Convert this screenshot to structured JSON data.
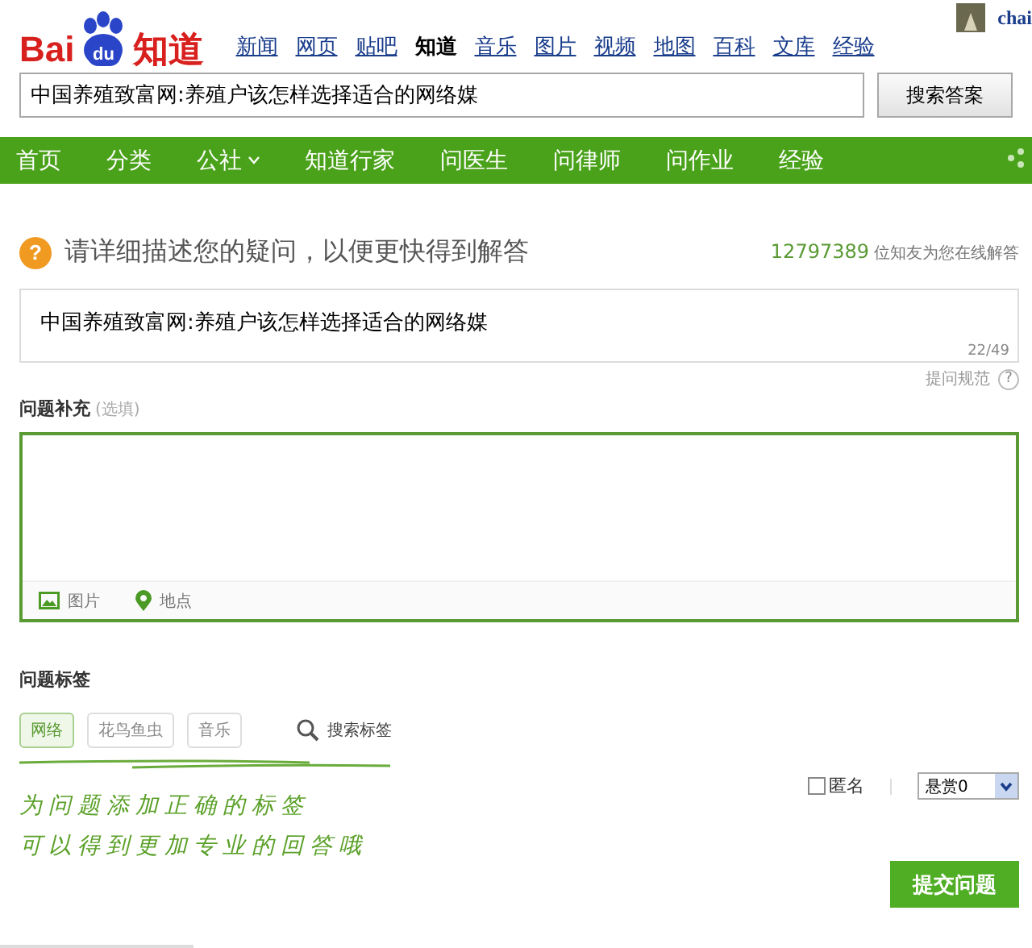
{
  "header": {
    "logo": {
      "prefix": "Bai",
      "badge": "du",
      "suffix": "知道"
    },
    "links": [
      {
        "label": "新闻",
        "selected": false
      },
      {
        "label": "网页",
        "selected": false
      },
      {
        "label": "贴吧",
        "selected": false
      },
      {
        "label": "知道",
        "selected": true
      },
      {
        "label": "音乐",
        "selected": false
      },
      {
        "label": "图片",
        "selected": false
      },
      {
        "label": "视频",
        "selected": false
      },
      {
        "label": "地图",
        "selected": false
      },
      {
        "label": "百科",
        "selected": false
      },
      {
        "label": "文库",
        "selected": false
      },
      {
        "label": "经验",
        "selected": false
      }
    ],
    "user": "chai",
    "search": {
      "value": "中国养殖致富网:养殖户该怎样选择适合的网络媒",
      "button": "搜索答案"
    }
  },
  "nav": [
    {
      "label": "首页",
      "dropdown": false
    },
    {
      "label": "分类",
      "dropdown": false
    },
    {
      "label": "公社",
      "dropdown": true
    },
    {
      "label": "知道行家",
      "dropdown": false
    },
    {
      "label": "问医生",
      "dropdown": false
    },
    {
      "label": "问律师",
      "dropdown": false
    },
    {
      "label": "问作业",
      "dropdown": false
    },
    {
      "label": "经验",
      "dropdown": false
    }
  ],
  "prompt": {
    "icon": "?",
    "text": "请详细描述您的疑问，以便更快得到解答",
    "count": "12797389",
    "count_suffix": "位知友为您在线解答"
  },
  "question": {
    "value": "中国养殖致富网:养殖户该怎样选择适合的网络媒",
    "counter": "22/49"
  },
  "rules_link": "提问规范",
  "rules_icon": "?",
  "details": {
    "label": "问题补充",
    "hint": "(选填)",
    "tools": [
      "图片",
      "地点"
    ]
  },
  "tags": {
    "label": "问题标签",
    "items": [
      {
        "label": "网络",
        "selected": true
      },
      {
        "label": "花鸟鱼虫",
        "selected": false
      },
      {
        "label": "音乐",
        "selected": false
      }
    ],
    "search": "搜索标签"
  },
  "annotation": [
    "为问题添加正确的标签",
    "可以得到更加专业的回答哦"
  ],
  "anonymous": {
    "label": "匿名",
    "checked": false
  },
  "reward": {
    "value": "悬赏0"
  },
  "submit": "提交问题"
}
